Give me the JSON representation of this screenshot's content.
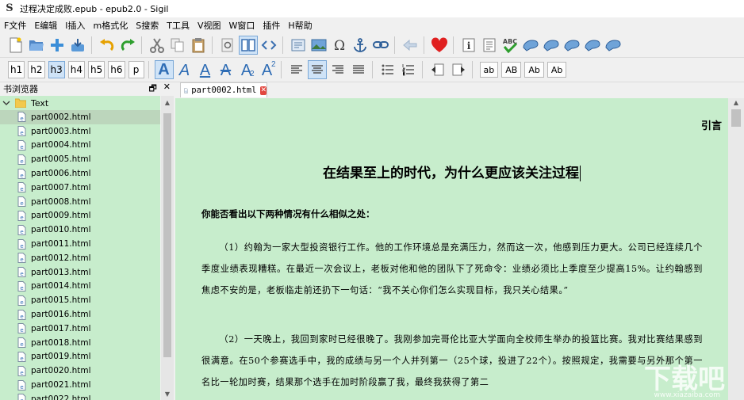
{
  "window": {
    "title": "过程决定成败.epub - epub2.0 - Sigil",
    "app_icon": "S"
  },
  "menu": [
    "F文件",
    "E编辑",
    "I插入",
    "m格式化",
    "S搜索",
    "T工具",
    "V视图",
    "W窗口",
    "插件",
    "H帮助"
  ],
  "toolbar2": {
    "headings": [
      "h1",
      "h2",
      "h3",
      "h4",
      "h5",
      "h6",
      "p"
    ],
    "active_heading": "h3",
    "case_buttons": [
      "ab",
      "AB",
      "Ab",
      "Ab"
    ],
    "sub_mark": "2",
    "sup_mark": "2"
  },
  "book_browser": {
    "title": "书浏览器",
    "float_glyph": "🗗",
    "close_glyph": "✕",
    "folder": "Text",
    "files": [
      "part0002.html",
      "part0003.html",
      "part0004.html",
      "part0005.html",
      "part0006.html",
      "part0007.html",
      "part0008.html",
      "part0009.html",
      "part0010.html",
      "part0011.html",
      "part0012.html",
      "part0013.html",
      "part0014.html",
      "part0015.html",
      "part0016.html",
      "part0017.html",
      "part0018.html",
      "part0019.html",
      "part0020.html",
      "part0021.html",
      "part0022.html"
    ],
    "selected": "part0002.html"
  },
  "editor": {
    "tab_label": "part0002.html",
    "tab_close": "✕",
    "chapter_label": "引言",
    "heading": "在结果至上的时代，为什么更应该关注过程",
    "question": "你能否看出以下两种情况有什么相似之处：",
    "paragraph1": "（1）约翰为一家大型投资银行工作。他的工作环境总是充满压力，然而这一次，他感到压力更大。公司已经连续几个季度业绩表现糟糕。在最近一次会议上，老板对他和他的团队下了死命令：业绩必须比上季度至少提高15%。让约翰感到焦虑不安的是，老板临走前还扔下一句话：“我不关心你们怎么实现目标，我只关心结果。”",
    "paragraph2": "（2）一天晚上，我回到家时已经很晚了。我刚参加完哥伦比亚大学面向全校师生举办的投篮比赛。我对比赛结果感到很满意。在50个参赛选手中，我的成绩与另一个人并列第一（25个球，投进了22个）。按照规定，我需要与另外那个第一名比一轮加时赛，结果那个选手在加时阶段赢了我，最终我获得了第二"
  },
  "watermark": {
    "text": "下载吧",
    "url": "www.xiazaiba.com"
  },
  "colors": {
    "editor_bg": "#c7edcc",
    "accent": "#2f6db5",
    "close_red": "#e2473f"
  }
}
